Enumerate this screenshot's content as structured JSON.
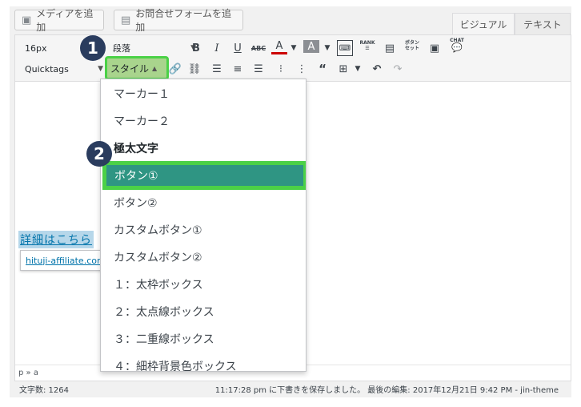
{
  "media_buttons": {
    "add_media": "メディアを追加",
    "add_form": "お問合せフォームを追加"
  },
  "tabs": {
    "visual": "ビジュアル",
    "text": "テキスト"
  },
  "toolbar": {
    "font_size": "16px",
    "format": "段落",
    "quicktags": "Quicktags",
    "style": "スタイル",
    "icons": [
      "bold-icon",
      "italic-icon",
      "underline-icon",
      "strikethrough-icon",
      "text-color-icon",
      "background-color-icon",
      "keyboard-icon",
      "rank-icon",
      "table-icon",
      "button-set-icon",
      "box-icon",
      "chat-icon",
      "link-icon",
      "unlink-icon",
      "align-left-icon",
      "align-center-icon",
      "align-right-icon",
      "bullet-list-icon",
      "numbered-list-icon",
      "blockquote-icon",
      "insert-table-icon",
      "undo-icon",
      "redo-icon"
    ],
    "rank_label": "RANK",
    "button_label": "ボタン\nセット",
    "chat_label": "CHAT",
    "bold": "B",
    "italic": "I",
    "underline": "U",
    "strike": "ABC",
    "color_a": "A"
  },
  "content": {
    "link_text": "詳細はこちら",
    "link_url": "hituji-affiliate.com"
  },
  "dropdown": {
    "items": [
      "マーカー１",
      "マーカー２",
      "極太文字",
      "ボタン①",
      "ボタン②",
      "カスタムボタン①",
      "カスタムボタン②",
      "１：太枠ボックス",
      "２：太点線ボックス",
      "３：二重線ボックス",
      "４：細枠背景色ボックス"
    ],
    "selected_index": 3
  },
  "badges": {
    "step1": "1",
    "step2": "2"
  },
  "statusbar": {
    "path": "p » a"
  },
  "footer": {
    "word_count": "文字数: 1264",
    "saved": "11:17:28 pm に下書きを保存しました。 最後の編集: 2017年12月21日 9:42 PM - jin-theme"
  },
  "colors": {
    "highlight_green": "#4bd147",
    "selected_teal": "#2f9583",
    "badge_navy": "#2a3c5e",
    "link_blue": "#0073aa"
  }
}
